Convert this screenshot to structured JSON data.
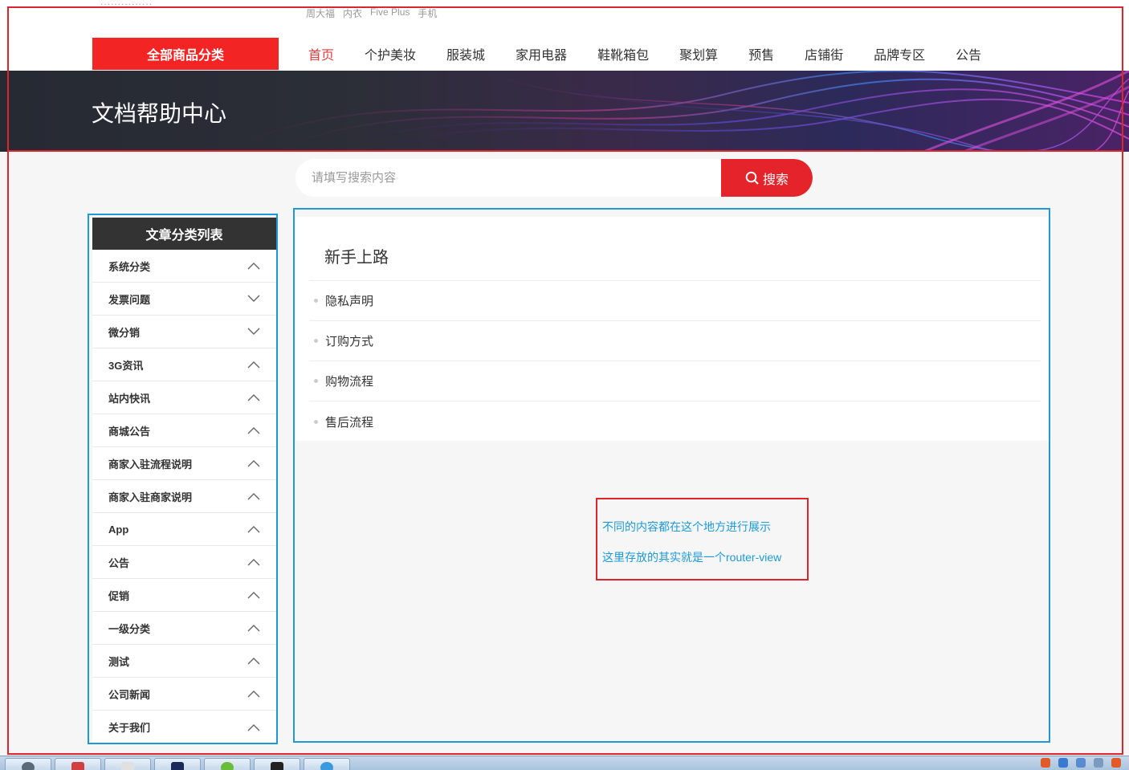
{
  "top_links": {
    "cut_text": "...............",
    "hot_words": [
      "周大福",
      "内衣",
      "Five Plus",
      "手机"
    ]
  },
  "nav": {
    "all_categories": "全部商品分类",
    "items": [
      {
        "label": "首页",
        "active": true
      },
      {
        "label": "个护美妆"
      },
      {
        "label": "服装城"
      },
      {
        "label": "家用电器"
      },
      {
        "label": "鞋靴箱包"
      },
      {
        "label": "聚划算"
      },
      {
        "label": "预售"
      },
      {
        "label": "店铺街"
      },
      {
        "label": "品牌专区"
      },
      {
        "label": "公告"
      }
    ]
  },
  "banner": {
    "title": "文档帮助中心"
  },
  "search": {
    "placeholder": "请填写搜索内容",
    "button": "搜索"
  },
  "sidebar": {
    "title": "文章分类列表",
    "items": [
      {
        "label": "系统分类",
        "chevron": "up"
      },
      {
        "label": "发票问题",
        "chevron": "down"
      },
      {
        "label": "微分销",
        "chevron": "down"
      },
      {
        "label": "3G资讯",
        "chevron": "up"
      },
      {
        "label": "站内快讯",
        "chevron": "up"
      },
      {
        "label": "商城公告",
        "chevron": "up"
      },
      {
        "label": "商家入驻流程说明",
        "chevron": "up"
      },
      {
        "label": "商家入驻商家说明",
        "chevron": "up"
      },
      {
        "label": "App",
        "chevron": "up"
      },
      {
        "label": "公告",
        "chevron": "up"
      },
      {
        "label": "促销",
        "chevron": "up"
      },
      {
        "label": "一级分类",
        "chevron": "up"
      },
      {
        "label": "测试",
        "chevron": "up"
      },
      {
        "label": "公司新闻",
        "chevron": "up"
      },
      {
        "label": "关于我们",
        "chevron": "up"
      }
    ]
  },
  "content": {
    "title": "新手上路",
    "articles": [
      "隐私声明",
      "订购方式",
      "购物流程",
      "售后流程"
    ]
  },
  "note": {
    "line1": "不同的内容都在这个地方进行展示",
    "line2": "这里存放的其实就是一个router-view"
  },
  "colors": {
    "brand_red": "#e4232a",
    "annotation_blue": "#1d9ad6",
    "annotation_red": "#e0242c"
  }
}
